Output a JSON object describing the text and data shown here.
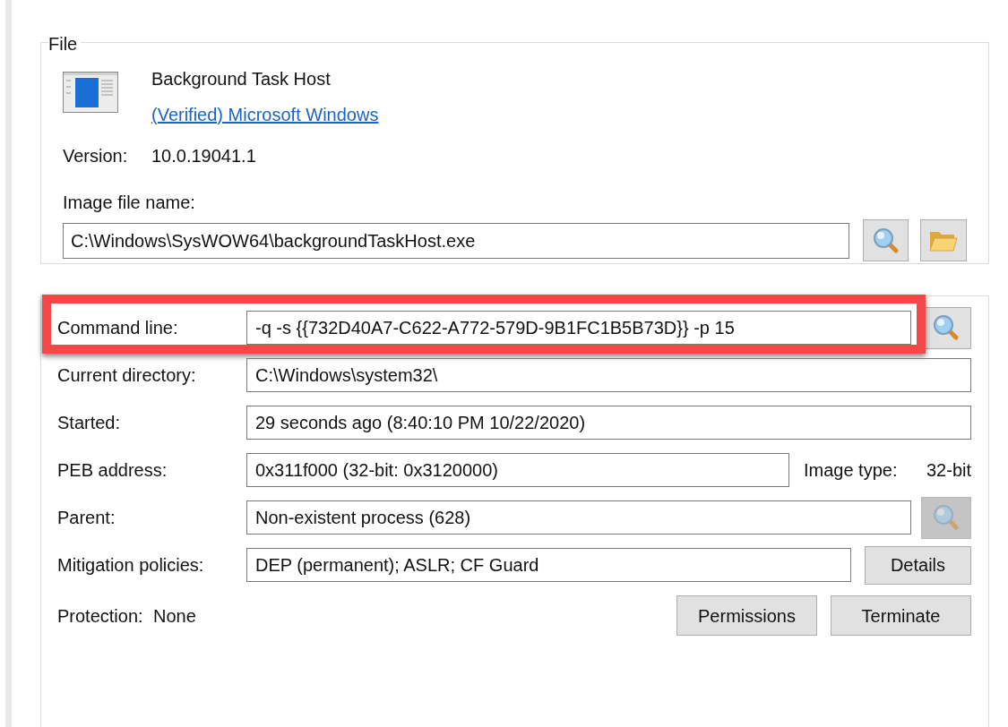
{
  "file": {
    "legend": "File",
    "name": "Background Task Host",
    "publisher": "(Verified) Microsoft Windows",
    "version_label": "Version:",
    "version": "10.0.19041.1",
    "image_label": "Image file name:",
    "image_path": "C:\\Windows\\SysWOW64\\backgroundTaskHost.exe"
  },
  "process": {
    "rows": [
      {
        "label": "Command line:",
        "value": "-q -s {{732D40A7-C622-A772-579D-9B1FC1B5B73D}} -p 15",
        "highlighted": true,
        "extra": {
          "kind": "search",
          "disabled": false
        }
      },
      {
        "label": "Current directory:",
        "value": "C:\\Windows\\system32\\",
        "highlighted": false
      },
      {
        "label": "Started:",
        "value": "29 seconds ago (8:40:10 PM 10/22/2020)",
        "highlighted": false
      },
      {
        "label": "PEB address:",
        "value": "0x311f000 (32-bit: 0x3120000)",
        "highlighted": false,
        "extra": {
          "kind": "note",
          "label": "Image type:",
          "value": "32-bit"
        }
      },
      {
        "label": "Parent:",
        "value": "Non-existent process (628)",
        "highlighted": false,
        "extra": {
          "kind": "search",
          "disabled": true
        }
      },
      {
        "label": "Mitigation policies:",
        "value": "DEP (permanent); ASLR; CF Guard",
        "highlighted": false,
        "extra": {
          "kind": "button",
          "label": "Details"
        }
      }
    ],
    "protection_label": "Protection:",
    "protection": "None",
    "buttons": [
      "Permissions",
      "Terminate"
    ]
  }
}
